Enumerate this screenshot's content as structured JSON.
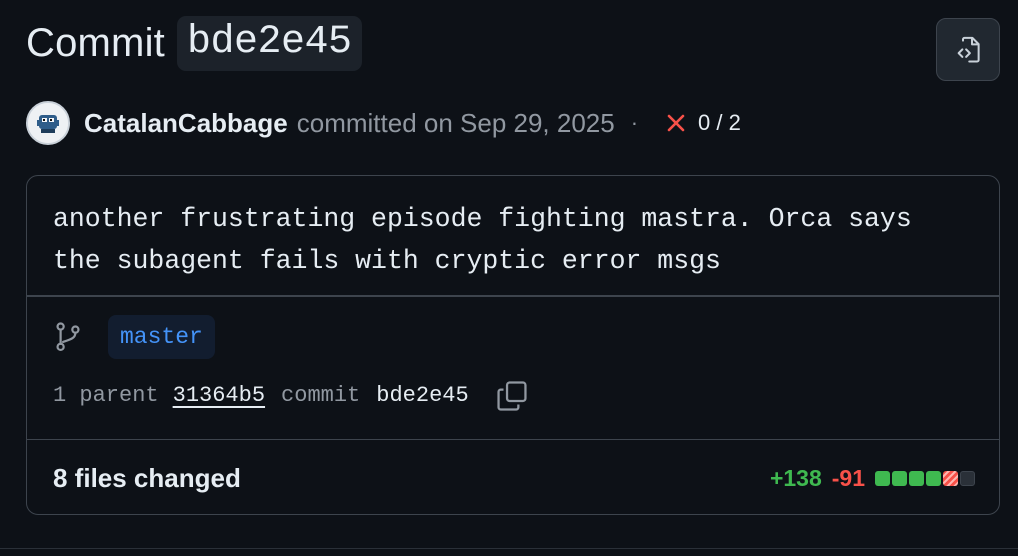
{
  "header": {
    "title_word": "Commit",
    "sha": "bde2e45"
  },
  "meta": {
    "author": "CatalanCabbage",
    "committed_text": "committed on Sep 29, 2025",
    "separator": "·",
    "checks": "0 / 2",
    "status": "failed"
  },
  "commit": {
    "message": "another frustrating episode fighting mastra. Orca says\nthe subagent fails with cryptic error msgs",
    "branch": "master",
    "parent_count_label": "1 parent",
    "parent_sha": "31364b5",
    "commit_label": "commit",
    "commit_sha": "bde2e45"
  },
  "files": {
    "changed_label": "8 files changed",
    "additions": "+138",
    "deletions": "-91",
    "diff_blocks": [
      "added",
      "added",
      "added",
      "added",
      "deleted",
      "neutral"
    ]
  },
  "colors": {
    "background": "#0d1117",
    "border": "#3d444d",
    "accent_blue": "#4493f8",
    "added": "#3fb950",
    "deleted": "#f85149",
    "muted": "#9198a1"
  },
  "icons": {
    "browse": "file-code-icon",
    "branch": "git-branch-icon",
    "copy": "copy-icon",
    "status": "x-icon"
  }
}
